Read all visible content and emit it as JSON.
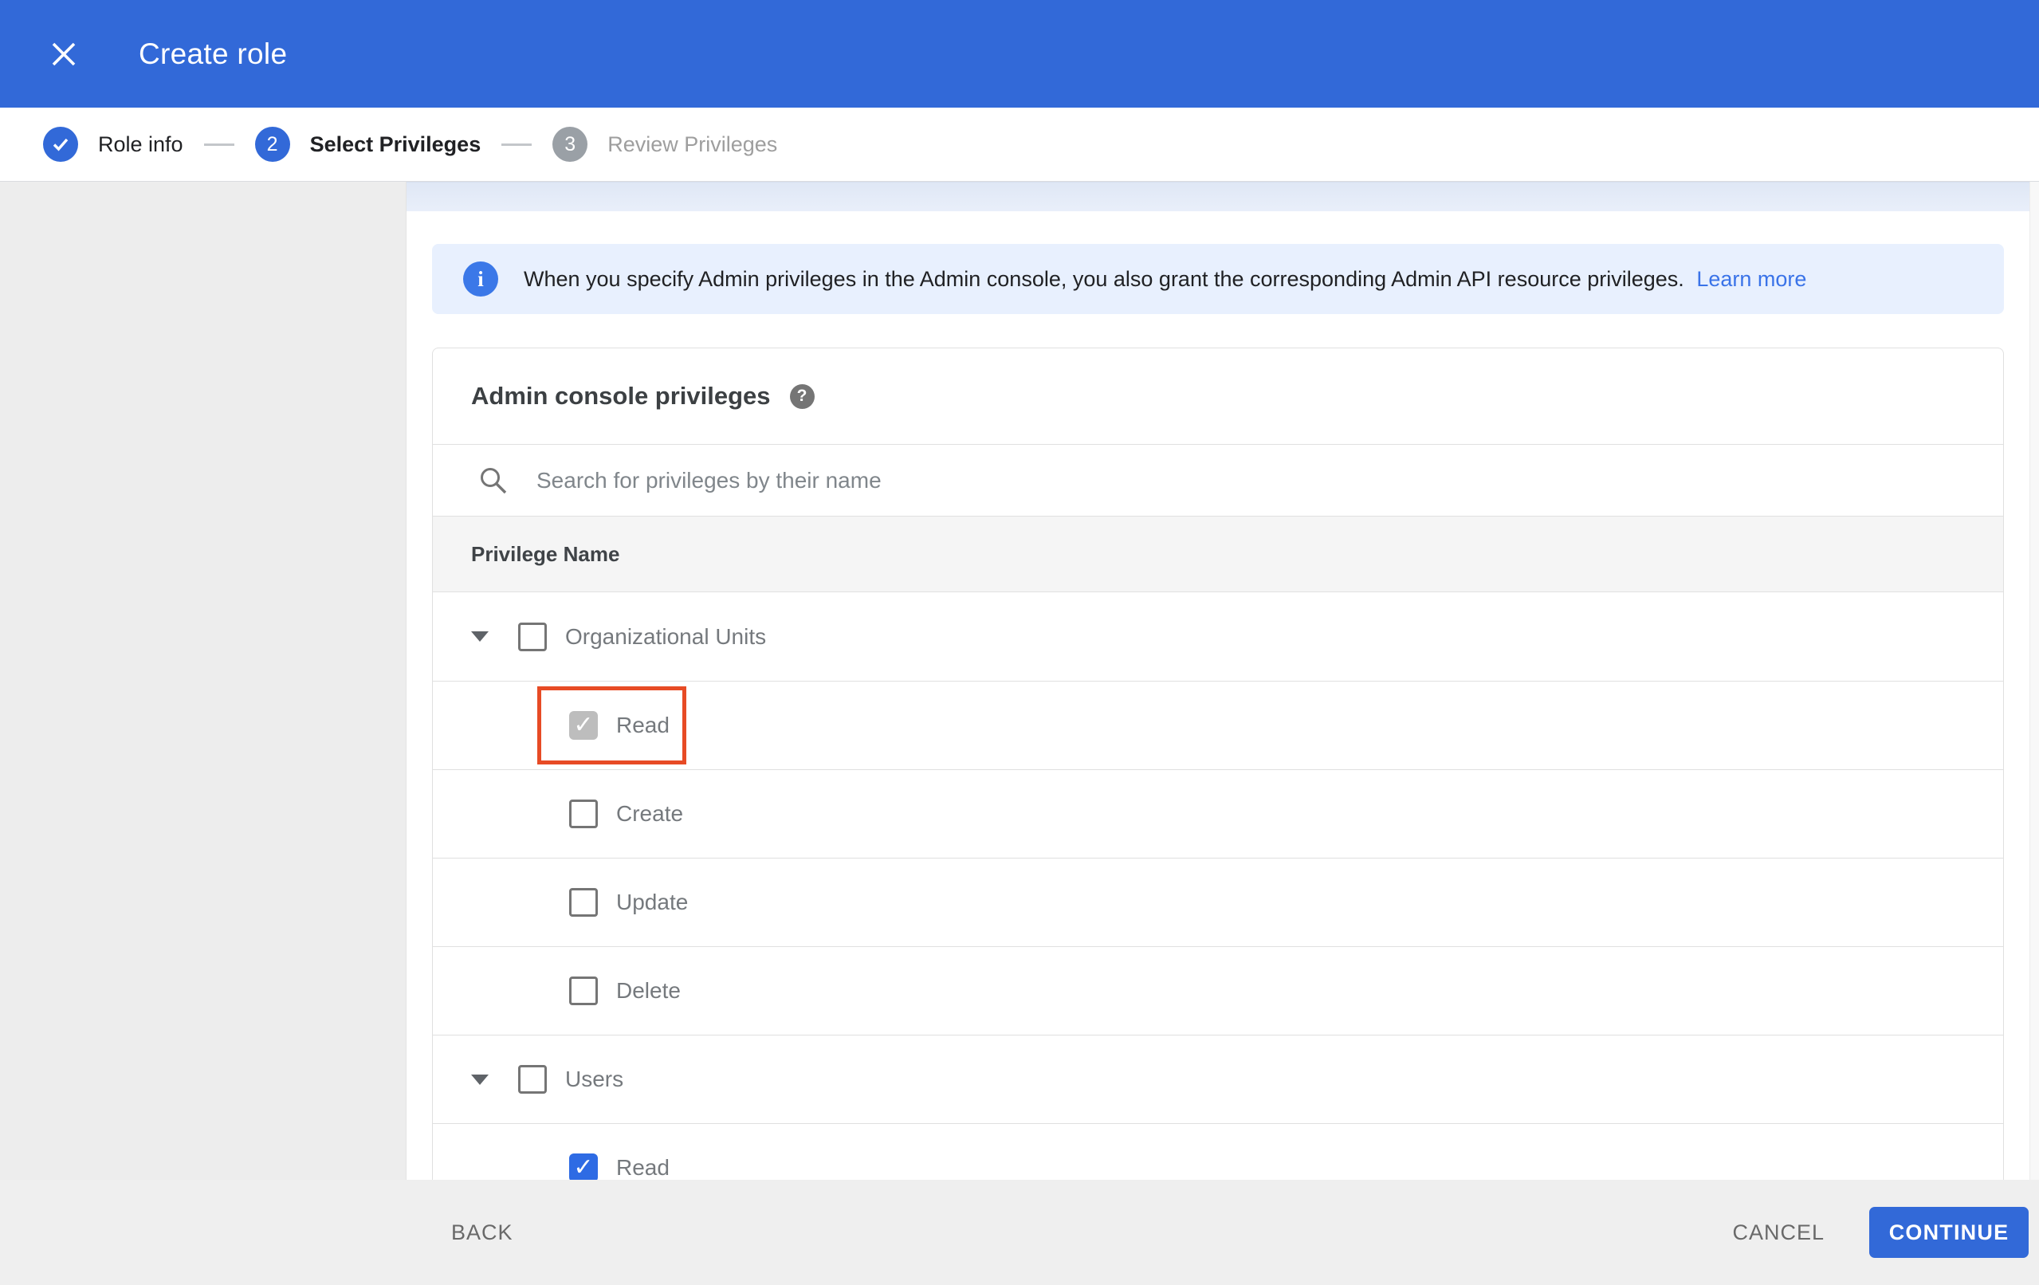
{
  "header": {
    "title": "Create role"
  },
  "stepper": {
    "steps": [
      {
        "label": "Role info",
        "state": "completed"
      },
      {
        "label": "Select Privileges",
        "number": "2",
        "state": "active"
      },
      {
        "label": "Review Privileges",
        "number": "3",
        "state": "upcoming"
      }
    ]
  },
  "banner": {
    "text": "When you specify Admin privileges in the Admin console, you also grant the corresponding Admin API resource privileges.",
    "link": "Learn more"
  },
  "card": {
    "title": "Admin console privileges",
    "search_placeholder": "Search for privileges by their name",
    "column_header": "Privilege Name"
  },
  "privileges": {
    "rows": [
      {
        "label": "Organizational Units",
        "type": "group",
        "expanded": true,
        "checkbox": "unchecked"
      },
      {
        "label": "Read",
        "type": "child",
        "checkbox": "checked-disabled",
        "highlighted": true
      },
      {
        "label": "Create",
        "type": "child",
        "checkbox": "unchecked"
      },
      {
        "label": "Update",
        "type": "child",
        "checkbox": "unchecked"
      },
      {
        "label": "Delete",
        "type": "child",
        "checkbox": "unchecked"
      },
      {
        "label": "Users",
        "type": "group",
        "expanded": true,
        "checkbox": "unchecked"
      },
      {
        "label": "Read",
        "type": "child",
        "checkbox": "checked"
      }
    ]
  },
  "footer": {
    "back": "BACK",
    "cancel": "CANCEL",
    "continue": "CONTINUE"
  },
  "colors": {
    "primary": "#3269d8",
    "checkbox_blue": "#2e6be4",
    "link_blue": "#3a73e8",
    "banner_bg": "#e8f0fe",
    "info_icon_blue": "#3b78e8",
    "highlight_red": "#e74b25",
    "sidebar_gray": "#ededed",
    "footer_gray": "#efefef",
    "table_header_bg": "#f5f5f5",
    "border_gray": "#e0e0e0",
    "disabled_check": "#bdbdbd",
    "step_inactive": "#9aa0a6",
    "text_dark": "#202124",
    "text_gray": "#75797d",
    "muted_text": "#9e9e9e"
  }
}
